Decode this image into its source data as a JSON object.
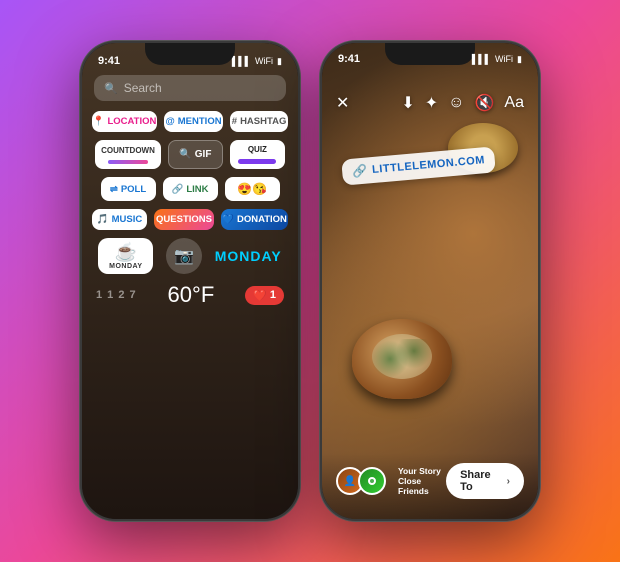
{
  "bg": {
    "gradient": "linear-gradient(135deg, #a855f7 0%, #ec4899 50%, #f97316 100%)"
  },
  "phone_left": {
    "status_time": "9:41",
    "search_placeholder": "Search",
    "stickers": {
      "row1": [
        {
          "id": "location",
          "icon": "📍",
          "label": "LOCATION",
          "type": "location"
        },
        {
          "id": "mention",
          "icon": "@",
          "label": "MENTION",
          "type": "mention"
        },
        {
          "id": "hashtag",
          "icon": "#",
          "label": "HASHTAG",
          "type": "hashtag"
        }
      ],
      "row2": [
        {
          "id": "countdown",
          "label": "COUNTDOWN",
          "type": "countdown"
        },
        {
          "id": "gif",
          "label": "GIF",
          "type": "gif"
        },
        {
          "id": "quiz",
          "label": "QUIZ",
          "type": "quiz"
        }
      ],
      "row3": [
        {
          "id": "poll",
          "icon": "⇌",
          "label": "POLL",
          "type": "poll"
        },
        {
          "id": "link",
          "icon": "🔗",
          "label": "LINK",
          "type": "link"
        },
        {
          "id": "emoji",
          "label": "😍😘",
          "type": "emoji"
        }
      ],
      "row4": [
        {
          "id": "music",
          "icon": "🎵",
          "label": "MUSIC",
          "type": "music"
        },
        {
          "id": "questions",
          "label": "QUESTIONS",
          "type": "questions"
        },
        {
          "id": "donation",
          "icon": "💙",
          "label": "DONATION",
          "type": "donation"
        }
      ]
    },
    "bottom_special": {
      "monday_icon": "☕",
      "monday_label": "MONDAY",
      "day_label": "MONDAY"
    },
    "temp_prefix": "1 1 2 7",
    "temp": "60°F",
    "heart_count": "1"
  },
  "phone_right": {
    "status_time": "9:41",
    "link_sticker_text": "LITTLELEMON.COM",
    "link_icon": "🔗",
    "share_button_label": "Share To",
    "share_labels": [
      "Your Story",
      "Close Friends"
    ]
  }
}
